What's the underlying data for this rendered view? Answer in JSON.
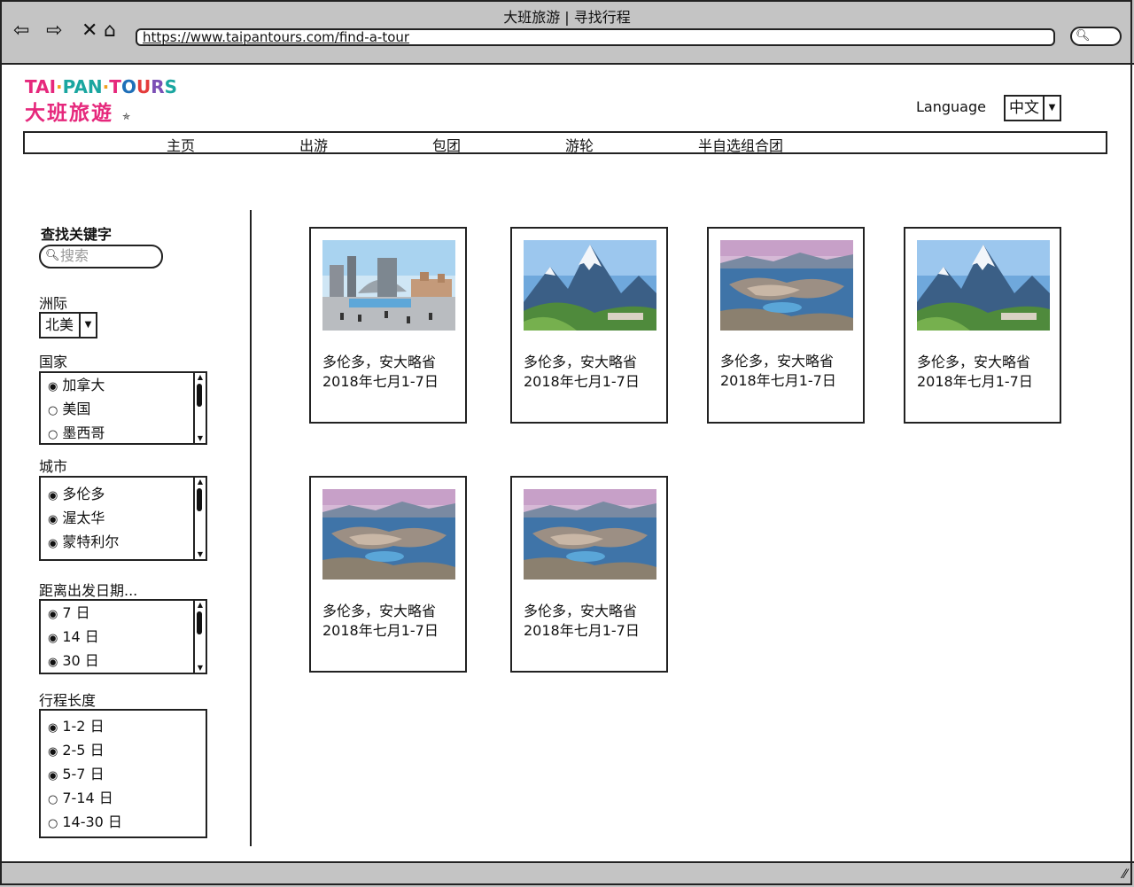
{
  "window": {
    "title": "大班旅游 | 寻找行程"
  },
  "browser": {
    "url": "https://www.taipantours.com/find-a-tour"
  },
  "logo": {
    "en": "TAI·PAN·TOURS",
    "zh": "大班旅遊"
  },
  "language": {
    "label": "Language",
    "value": "中文"
  },
  "nav": [
    "主页",
    "出游",
    "包团",
    "游轮",
    "半自选组合团"
  ],
  "filters": {
    "keyword_label": "查找关键字",
    "keyword_placeholder": "搜索",
    "continent_label": "洲际",
    "continent_value": "北美",
    "country_label": "国家",
    "countries": [
      "加拿大",
      "美国",
      "墨西哥"
    ],
    "city_label": "城市",
    "cities": [
      "多伦多",
      "渥太华",
      "蒙特利尔"
    ],
    "departure_label": "距离出发日期...",
    "departure": [
      "7 日",
      "14 日",
      "30 日"
    ],
    "length_label": "行程长度",
    "lengths": [
      "1-2 日",
      "2-5 日",
      "5-7 日",
      "7-14 日",
      "14-30 日"
    ]
  },
  "tours": [
    {
      "title": "多伦多，安大略省",
      "dates": "2018年七月1-7日",
      "image": "toronto-city-hall-photo"
    },
    {
      "title": "多伦多，安大略省",
      "dates": "2018年七月1-7日",
      "image": "mountain-valley-photo"
    },
    {
      "title": "多伦多，安大略省",
      "dates": "2018年七月1-7日",
      "image": "harbour-city-aerial-photo"
    },
    {
      "title": "多伦多，安大略省",
      "dates": "2018年七月1-7日",
      "image": "mountain-valley-photo"
    },
    {
      "title": "多伦多，安大略省",
      "dates": "2018年七月1-7日",
      "image": "harbour-city-aerial-photo"
    },
    {
      "title": "多伦多，安大略省",
      "dates": "2018年七月1-7日",
      "image": "harbour-city-aerial-photo"
    }
  ]
}
